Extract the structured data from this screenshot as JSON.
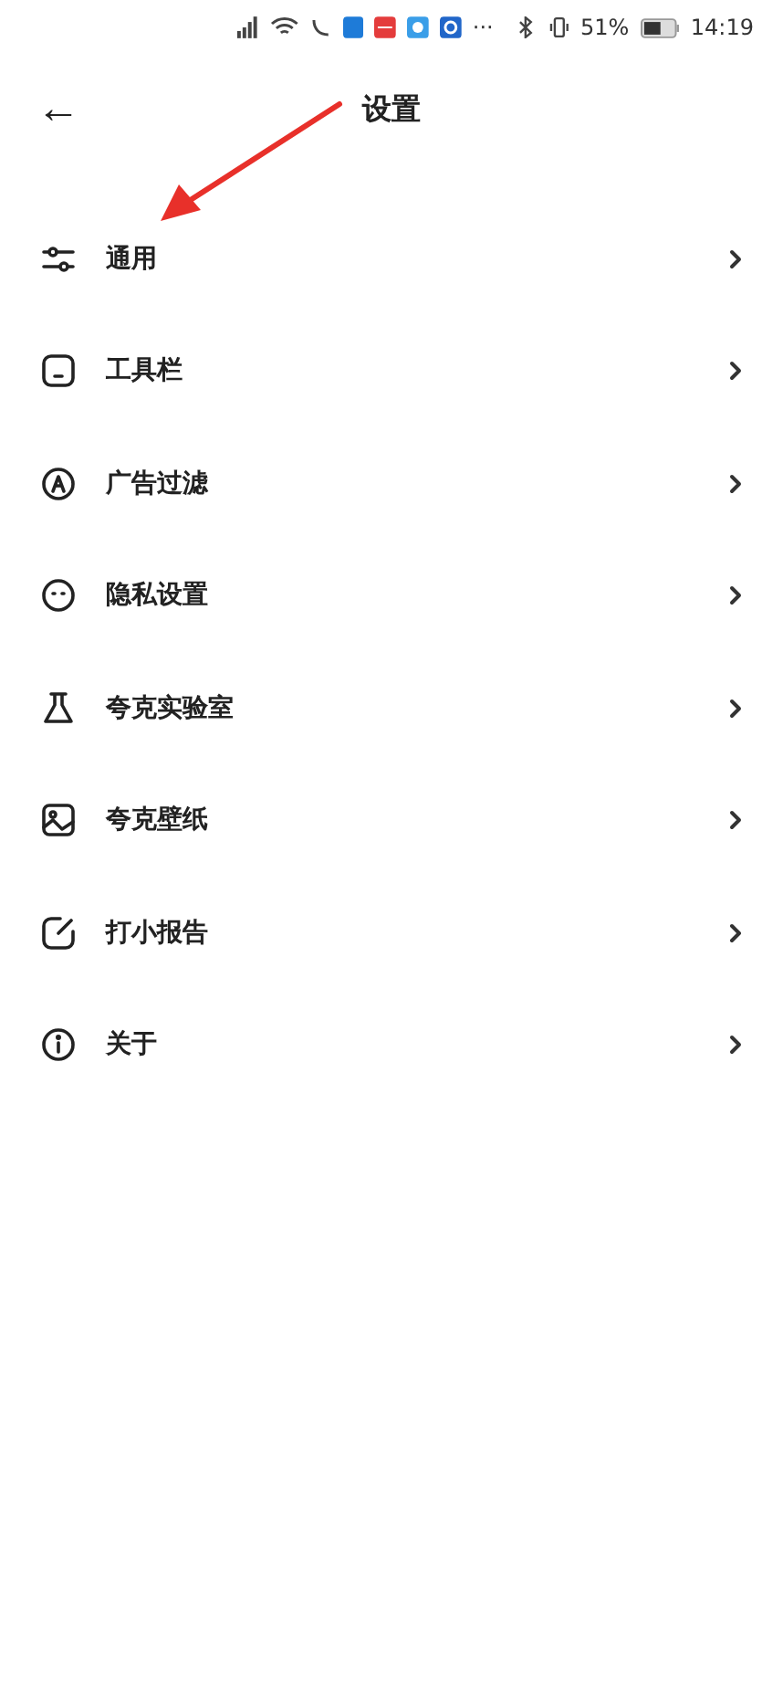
{
  "status_bar": {
    "more": "···",
    "battery": "51%",
    "time": "14:19"
  },
  "header": {
    "back": "←",
    "title": "设置"
  },
  "items": [
    {
      "kind": "sliders",
      "label": "通用"
    },
    {
      "kind": "toolbar",
      "label": "工具栏"
    },
    {
      "kind": "adblock",
      "label": "广告过滤"
    },
    {
      "kind": "privacy",
      "label": "隐私设置"
    },
    {
      "kind": "lab",
      "label": "夸克实验室"
    },
    {
      "kind": "wallpaper",
      "label": "夸克壁纸"
    },
    {
      "kind": "report",
      "label": "打小报告"
    },
    {
      "kind": "about",
      "label": "关于"
    }
  ]
}
